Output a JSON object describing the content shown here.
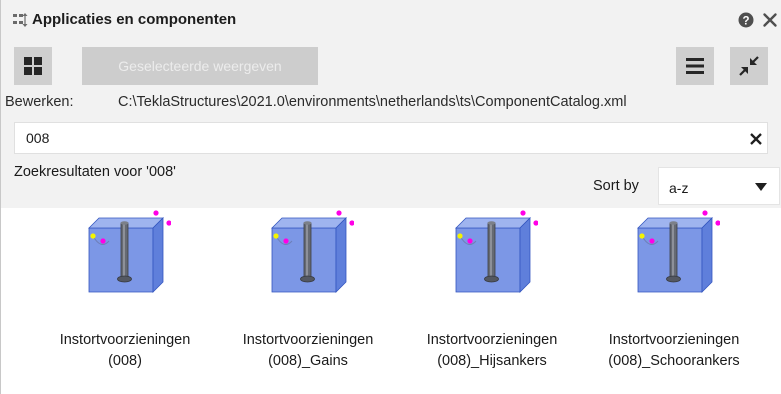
{
  "window": {
    "title": "Applicaties en componenten",
    "title_icon": "catalog-icon",
    "help_icon": "help-icon",
    "close_icon": "close-icon"
  },
  "toolbar": {
    "grid_view_icon": "grid-view-icon",
    "show_selected_label": "Geselecteerde weergeven",
    "list_icon": "hamburger-menu-icon",
    "collapse_icon": "collapse-arrows-icon"
  },
  "path": {
    "label": "Bewerken:",
    "value": "C:\\TeklaStructures\\2021.0\\environments\\netherlands\\ts\\ComponentCatalog.xml"
  },
  "search": {
    "value": "008",
    "clear_icon": "clear-icon"
  },
  "results": {
    "heading": "Zoekresultaten voor '008'",
    "sort_label": "Sort by",
    "sort_value": "a-z",
    "items": [
      {
        "line1": "Instortvoorzieningen",
        "line2": "(008)",
        "icon": "component-thumbnail-icon"
      },
      {
        "line1": "Instortvoorzieningen",
        "line2": "(008)_Gains",
        "icon": "component-thumbnail-icon"
      },
      {
        "line1": "Instortvoorzieningen",
        "line2": "(008)_Hijsankers",
        "icon": "component-thumbnail-icon"
      },
      {
        "line1": "Instortvoorzieningen",
        "line2": "(008)_Schoorankers",
        "icon": "component-thumbnail-icon"
      }
    ]
  },
  "colors": {
    "panel_background": "#f2f2f2",
    "button_background": "#cfcfcf",
    "box_fill": "#7c97e6",
    "point_magenta": "#ff00e6",
    "point_yellow": "#f4f400"
  }
}
